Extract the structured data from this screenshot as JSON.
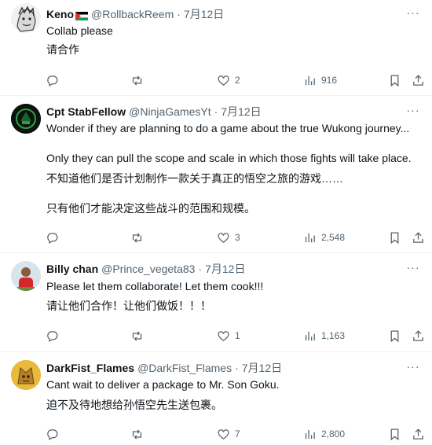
{
  "replies": [
    {
      "name": "Keno",
      "handle": "@RollbackReem",
      "sep": "·",
      "date": "7月12日",
      "lines": [
        "Collab please",
        "请合作"
      ],
      "replies_count": "",
      "retweets_count": "",
      "likes": "2",
      "views": "916"
    },
    {
      "name": "Cpt StabFellow",
      "handle": "@NinjaGamesYt",
      "sep": "·",
      "date": "7月12日",
      "lines": [
        "Wonder if they are planning to do a game about the true Wukong journey...",
        "Only they can pull the scope and scale in which those fights will take place.",
        "不知道他们是否计划制作一款关于真正的悟空之旅的游戏……",
        "只有他们才能决定这些战斗的范围和规模。"
      ],
      "likes": "3",
      "views": "2,548"
    },
    {
      "name": "Billy chan",
      "handle": "@Prince_vegeta83",
      "sep": "·",
      "date": "7月12日",
      "lines": [
        "Please let them collaborate! Let them cook!!!",
        "请让他们合作！让他们做饭！！！"
      ],
      "likes": "1",
      "views": "1,163"
    },
    {
      "name": "DarkFist_Flames",
      "handle": "@DarkFist_Flames",
      "sep": "·",
      "date": "7月12日",
      "lines": [
        "Cant wait to deliver a package to Mr. Son Goku.",
        "迫不及待地想给孙悟空先生送包裹。"
      ],
      "likes": "7",
      "views": "2,800"
    }
  ],
  "icons": {
    "reply": "reply-icon",
    "retweet": "retweet-icon",
    "like": "heart-icon",
    "views": "views-icon",
    "bookmark": "bookmark-icon",
    "share": "share-icon",
    "more": "more-icon"
  },
  "colors": {
    "text": "#0f1419",
    "secondary": "#536471",
    "divider": "#eff3f4"
  }
}
